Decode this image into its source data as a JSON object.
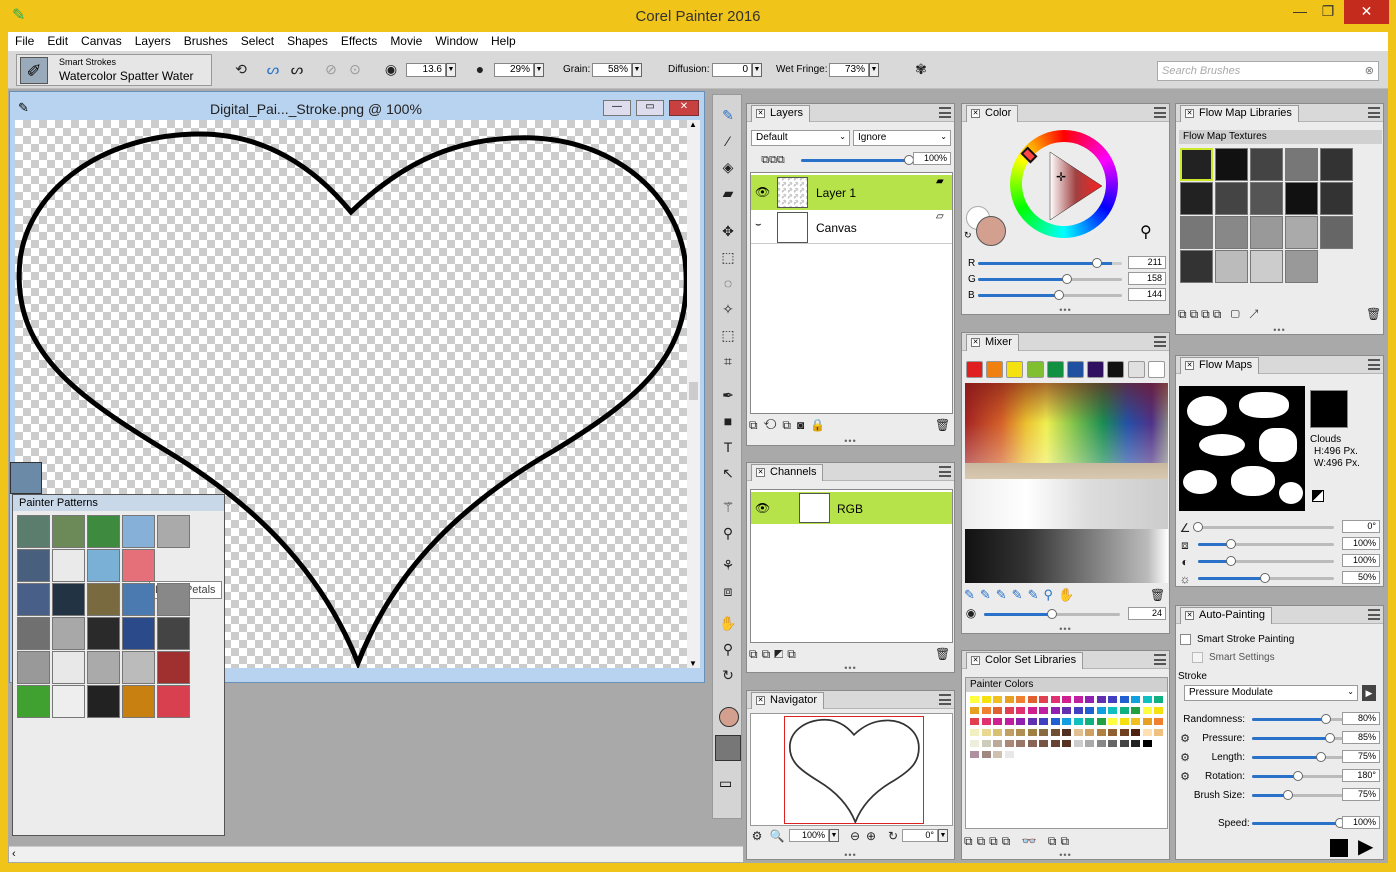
{
  "app": {
    "title": "Corel Painter 2016"
  },
  "menu": [
    "File",
    "Edit",
    "Canvas",
    "Layers",
    "Brushes",
    "Select",
    "Shapes",
    "Effects",
    "Movie",
    "Window",
    "Help"
  ],
  "property_bar": {
    "brush_category": "Smart Strokes",
    "brush_variant": "Watercolor Spatter Water",
    "size": "13.6",
    "opacity": "29%",
    "grain_label": "Grain:",
    "grain": "58%",
    "diffusion_label": "Diffusion:",
    "diffusion": "0",
    "wet_fringe_label": "Wet Fringe:",
    "wet_fringe": "73%",
    "search_placeholder": "Search Brushes"
  },
  "document": {
    "title": "Digital_Pai..._Stroke.png @ 100%"
  },
  "patterns": {
    "title": "Painter Patterns",
    "tooltip": "Lotus Petals"
  },
  "layers": {
    "tab": "Layers",
    "composite_method": "Default",
    "composite_depth": "Ignore",
    "opacity": "100%",
    "opacity_value": 100,
    "items": [
      {
        "name": "Layer 1",
        "selected": true
      },
      {
        "name": "Canvas",
        "selected": false
      }
    ]
  },
  "channels": {
    "tab": "Channels",
    "items": [
      {
        "name": "RGB",
        "selected": true
      }
    ]
  },
  "navigator": {
    "tab": "Navigator",
    "zoom": "100%",
    "rotation": "0°"
  },
  "color": {
    "tab": "Color",
    "main_color": "#d3a090",
    "r_label": "R",
    "r": "211",
    "r_value": 211,
    "g_label": "G",
    "g": "158",
    "g_value": 158,
    "b_label": "B",
    "b": "144",
    "b_value": 144
  },
  "mixer": {
    "tab": "Mixer",
    "swatches": [
      "#e02020",
      "#f08010",
      "#f5e010",
      "#80c030",
      "#109040",
      "#2050a0",
      "#301060",
      "#111111",
      "#e0e0e0",
      "#ffffff"
    ],
    "brush_size": "24"
  },
  "color_sets": {
    "tab": "Color Set Libraries",
    "set_name": "Painter Colors"
  },
  "flow_map_libraries": {
    "tab": "Flow Map Libraries",
    "section": "Flow Map Textures"
  },
  "flow_maps": {
    "tab": "Flow Maps",
    "name": "Clouds",
    "height": "H:496 Px.",
    "width": "W:496 Px.",
    "rows": [
      {
        "icon": "angle-icon",
        "value": "0°",
        "level": 0
      },
      {
        "icon": "scale-icon",
        "value": "100%",
        "level": 0.24
      },
      {
        "icon": "contrast-icon",
        "value": "100%",
        "level": 0.24
      },
      {
        "icon": "brightness-icon",
        "value": "50%",
        "level": 0.49
      }
    ]
  },
  "auto_painting": {
    "tab": "Auto-Painting",
    "smart_stroke": "Smart Stroke Painting",
    "smart_settings": "Smart Settings",
    "stroke_label": "Stroke",
    "stroke": "Pressure Modulate",
    "params": [
      {
        "label": "Randomness:",
        "value": "80%",
        "level": 0.8
      },
      {
        "label": "Pressure:",
        "value": "85%",
        "level": 0.85
      },
      {
        "label": "Length:",
        "value": "75%",
        "level": 0.75
      },
      {
        "label": "Rotation:",
        "value": "180°",
        "level": 0.5
      },
      {
        "label": "Brush Size:",
        "value": "75%",
        "level": 0.39
      }
    ],
    "speed_label": "Speed:",
    "speed": "100%"
  }
}
